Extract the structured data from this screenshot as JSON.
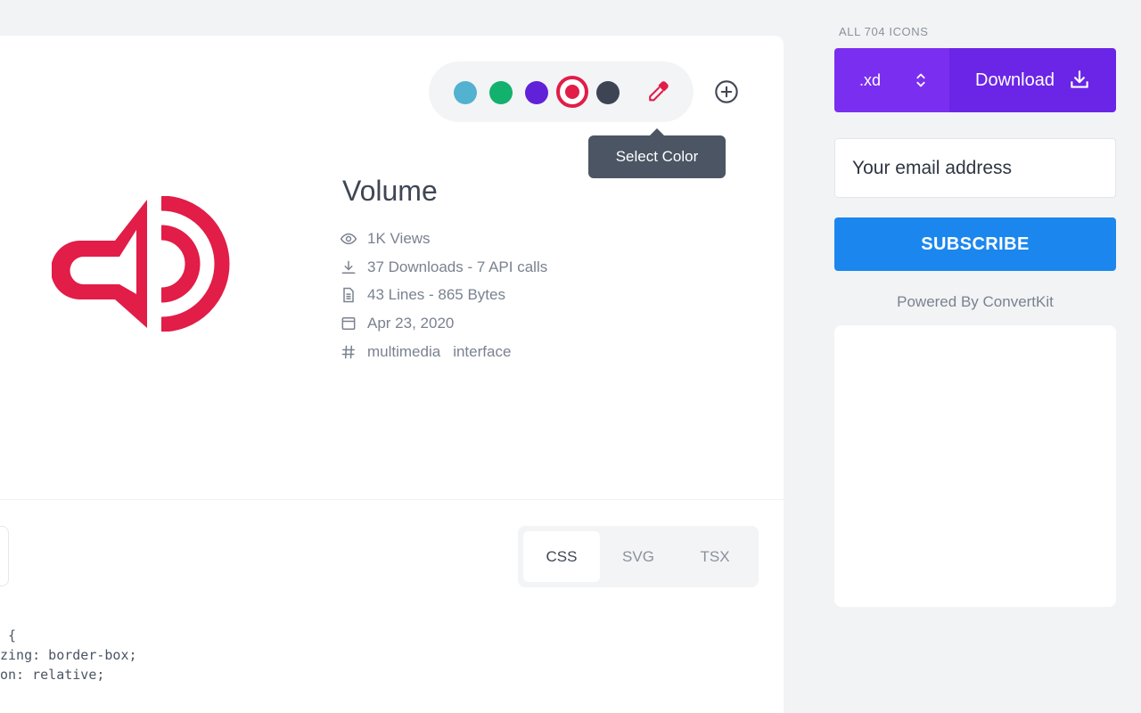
{
  "icon": {
    "title": "Volume",
    "color": "#e11d48",
    "preview_icon": "volume-icon"
  },
  "colors": {
    "swatches": [
      {
        "name": "cyan",
        "hex": "#52b2cf"
      },
      {
        "name": "green",
        "hex": "#12b16e"
      },
      {
        "name": "violet",
        "hex": "#6021d8"
      },
      {
        "name": "crimson",
        "hex": "#e11d48",
        "selected": true
      },
      {
        "name": "slate",
        "hex": "#3d4555"
      }
    ],
    "picker_icon": "eyedropper-icon",
    "add_icon": "plus-circle-icon",
    "tooltip": "Select Color"
  },
  "meta": {
    "views": "1K Views",
    "downloads": "37 Downloads - 7 API calls",
    "size": "43 Lines - 865 Bytes",
    "date": "Apr 23, 2020",
    "tags": [
      "multimedia",
      "interface"
    ]
  },
  "tabs": [
    {
      "label": "CSS",
      "active": true
    },
    {
      "label": "SVG",
      "active": false
    },
    {
      "label": "TSX",
      "active": false
    }
  ],
  "code": {
    "line1": " {",
    "line2": "zing: border-box;",
    "line3": "on: relative;"
  },
  "sidebar": {
    "label": "ALL 704 ICONS",
    "format": ".xd",
    "download_label": "Download",
    "email_placeholder": "Your email address",
    "subscribe_label": "SUBSCRIBE",
    "powered_by": "Powered By ConvertKit"
  }
}
